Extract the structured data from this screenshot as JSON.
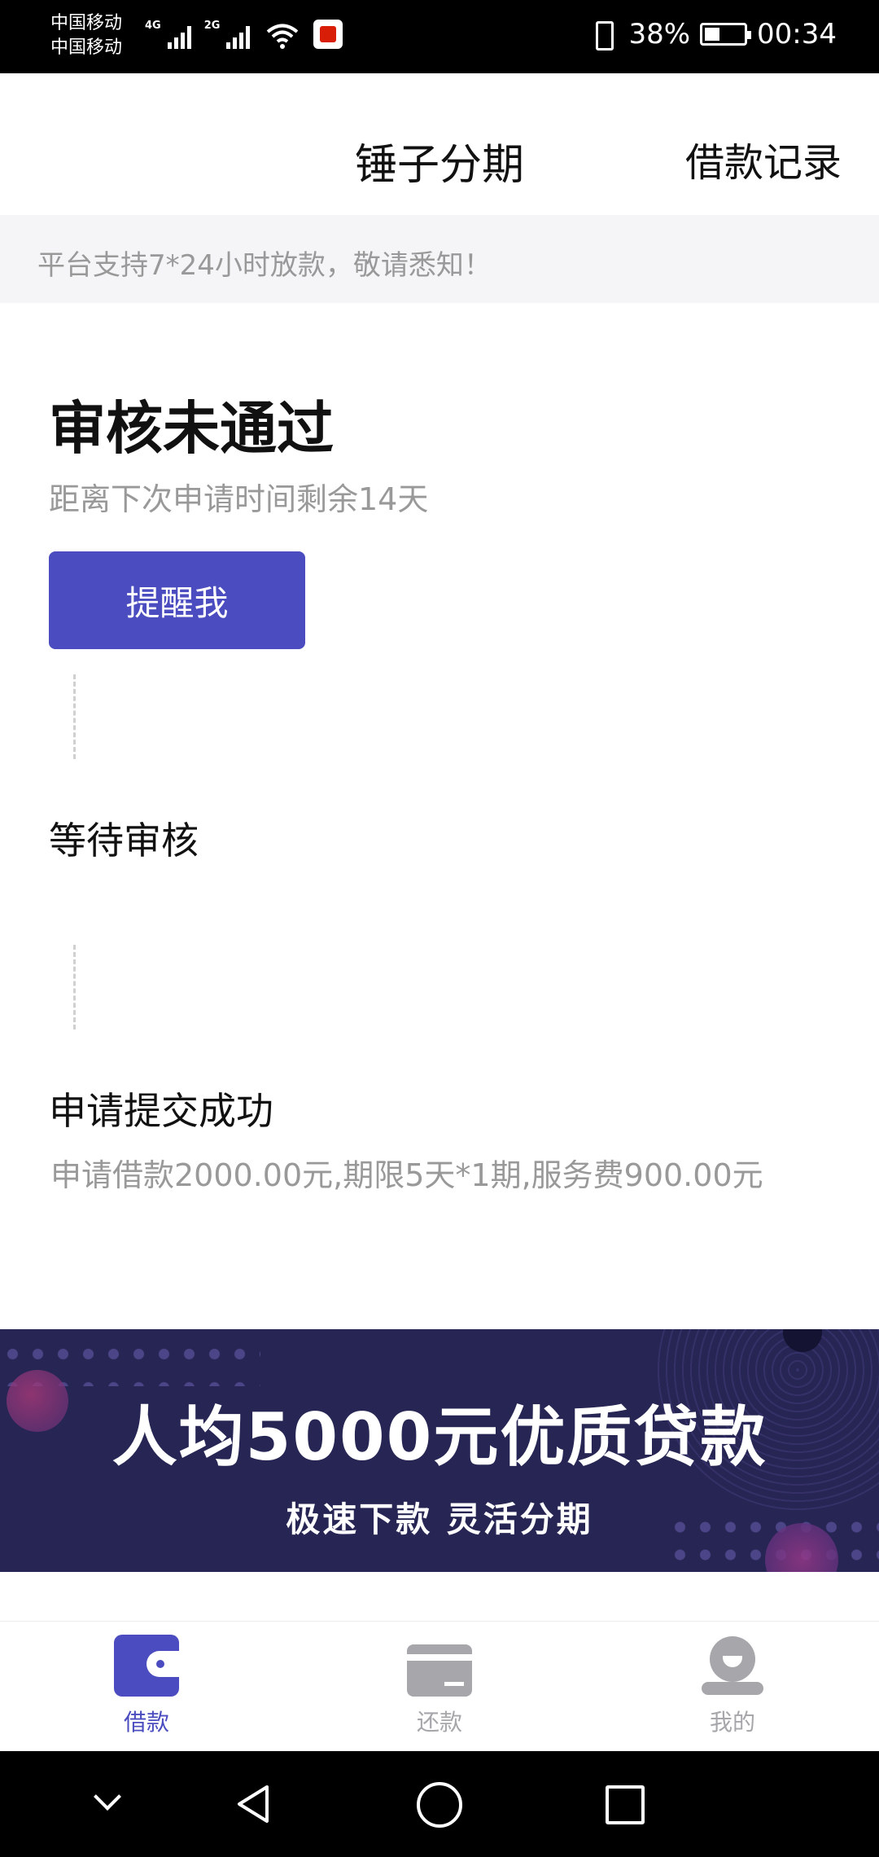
{
  "status_bar": {
    "carrier_1": "中国移动",
    "carrier_2": "中国移动",
    "net_1": "4G",
    "net_2": "2G",
    "battery": "38%",
    "time": "00:34"
  },
  "header": {
    "title": "锤子分期",
    "right_link": "借款记录"
  },
  "notice": "平台支持7*24小时放款，敬请悉知！",
  "status": {
    "title": "审核未通过",
    "subtitle": "距离下次申请时间剩余14天",
    "remind_button": "提醒我"
  },
  "timeline": [
    {
      "label": "等待审核",
      "desc": ""
    },
    {
      "label": "申请提交成功",
      "desc": "申请借款2000.00元,期限5天*1期,服务费900.00元"
    }
  ],
  "banner": {
    "headline": "人均5000元优质贷款",
    "subline": "极速下款 灵活分期"
  },
  "tabs": [
    {
      "label": "借款",
      "icon": "wallet-icon",
      "active": true
    },
    {
      "label": "还款",
      "icon": "card-icon",
      "active": false
    },
    {
      "label": "我的",
      "icon": "user-icon",
      "active": false
    }
  ],
  "colors": {
    "accent": "#4a4cbf",
    "inactive": "#a6a6ab",
    "banner_bg": "#262553"
  }
}
